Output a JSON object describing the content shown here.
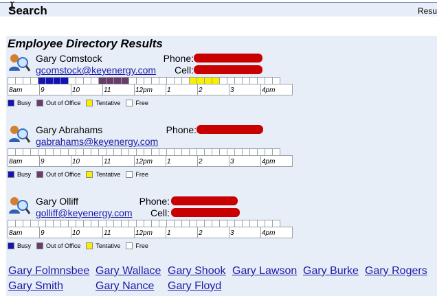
{
  "header": {
    "title": "Search",
    "right_text": "Resu"
  },
  "results": {
    "title": "Employee Directory Results",
    "phone_label": "Phone:",
    "cell_label": "Cell:",
    "hours": [
      "8am",
      "9",
      "10",
      "11",
      "12pm",
      "1",
      "2",
      "3",
      "4pm"
    ],
    "legend": [
      "Busy",
      "Out of Office",
      "Tentative",
      "Free"
    ],
    "colors": {
      "busy": "#1414b4",
      "out_of_office": "#6a3c6a",
      "tentative": "#f8f000",
      "free": "#ffffff"
    },
    "employees": [
      {
        "name": "Gary Comstock",
        "email": "gcomstock@keyenergy.com",
        "has_cell": true,
        "slots": [
          0,
          0,
          0,
          0,
          1,
          1,
          1,
          1,
          0,
          0,
          0,
          0,
          3,
          3,
          3,
          3,
          0,
          0,
          0,
          0,
          0,
          0,
          0,
          0,
          2,
          2,
          2,
          2,
          0,
          0,
          0,
          0,
          0,
          0,
          0,
          0
        ]
      },
      {
        "name": "Gary Abrahams",
        "email": "gabrahams@keyenergy.com",
        "has_cell": false,
        "slots": [
          0,
          0,
          0,
          0,
          0,
          0,
          0,
          0,
          0,
          0,
          0,
          0,
          0,
          0,
          0,
          0,
          0,
          0,
          0,
          0,
          0,
          0,
          0,
          0,
          0,
          0,
          0,
          0,
          0,
          0,
          0,
          0,
          0,
          0,
          0,
          0
        ]
      },
      {
        "name": "Gary Olliff",
        "email": "golliff@keyenergy.com",
        "has_cell": true,
        "slots": [
          0,
          0,
          0,
          0,
          0,
          0,
          0,
          0,
          0,
          0,
          0,
          0,
          0,
          0,
          0,
          0,
          0,
          0,
          0,
          0,
          0,
          0,
          0,
          0,
          0,
          0,
          0,
          0,
          0,
          0,
          0,
          0,
          0,
          0,
          0,
          0
        ]
      }
    ],
    "more_links": [
      "Gary Folmnsbee",
      "Gary Wallace",
      "Gary Shook",
      "Gary Lawson",
      "Gary Burke",
      "Gary Rogers",
      "Gary Smith",
      "Gary Nance",
      "Gary Floyd"
    ]
  }
}
